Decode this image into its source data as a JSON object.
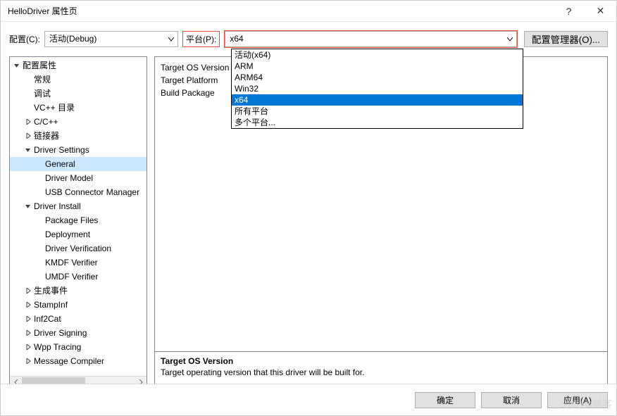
{
  "titlebar": {
    "title": "HelloDriver 属性页",
    "help": "?",
    "close": "✕"
  },
  "toolbar": {
    "config_label": "配置(C):",
    "config_value": "活动(Debug)",
    "platform_label": "平台(P):",
    "platform_value": "x64",
    "cfgmgr_label": "配置管理器(O)..."
  },
  "dropdown": {
    "options": [
      {
        "label": "活动(x64)",
        "selected": false
      },
      {
        "label": "ARM",
        "selected": false
      },
      {
        "label": "ARM64",
        "selected": false
      },
      {
        "label": "Win32",
        "selected": false
      },
      {
        "label": "x64",
        "selected": true
      },
      {
        "label": "所有平台",
        "selected": false
      },
      {
        "label": "多个平台...",
        "selected": false
      }
    ]
  },
  "tree": [
    {
      "depth": 0,
      "exp": "open",
      "label": "配置属性"
    },
    {
      "depth": 1,
      "exp": "none",
      "label": "常规"
    },
    {
      "depth": 1,
      "exp": "none",
      "label": "调试"
    },
    {
      "depth": 1,
      "exp": "none",
      "label": "VC++ 目录"
    },
    {
      "depth": 1,
      "exp": "closed",
      "label": "C/C++"
    },
    {
      "depth": 1,
      "exp": "closed",
      "label": "链接器"
    },
    {
      "depth": 1,
      "exp": "open",
      "label": "Driver Settings"
    },
    {
      "depth": 2,
      "exp": "none",
      "label": "General",
      "selected": true
    },
    {
      "depth": 2,
      "exp": "none",
      "label": "Driver Model"
    },
    {
      "depth": 2,
      "exp": "none",
      "label": "USB Connector Manager"
    },
    {
      "depth": 1,
      "exp": "open",
      "label": "Driver Install"
    },
    {
      "depth": 2,
      "exp": "none",
      "label": "Package Files"
    },
    {
      "depth": 2,
      "exp": "none",
      "label": "Deployment"
    },
    {
      "depth": 2,
      "exp": "none",
      "label": "Driver Verification"
    },
    {
      "depth": 2,
      "exp": "none",
      "label": "KMDF Verifier"
    },
    {
      "depth": 2,
      "exp": "none",
      "label": "UMDF Verifier"
    },
    {
      "depth": 1,
      "exp": "closed",
      "label": "生成事件"
    },
    {
      "depth": 1,
      "exp": "closed",
      "label": "StampInf"
    },
    {
      "depth": 1,
      "exp": "closed",
      "label": "Inf2Cat"
    },
    {
      "depth": 1,
      "exp": "closed",
      "label": "Driver Signing"
    },
    {
      "depth": 1,
      "exp": "closed",
      "label": "Wpp Tracing"
    },
    {
      "depth": 1,
      "exp": "closed",
      "label": "Message Compiler"
    }
  ],
  "properties": [
    {
      "name": "Target OS Version"
    },
    {
      "name": "Target Platform"
    },
    {
      "name": "Build Package"
    }
  ],
  "description": {
    "title": "Target OS Version",
    "text": "Target operating version that this driver will be built for."
  },
  "footer": {
    "ok": "确定",
    "cancel": "取消",
    "apply": "应用(A)"
  },
  "watermark": "51CTO博客"
}
